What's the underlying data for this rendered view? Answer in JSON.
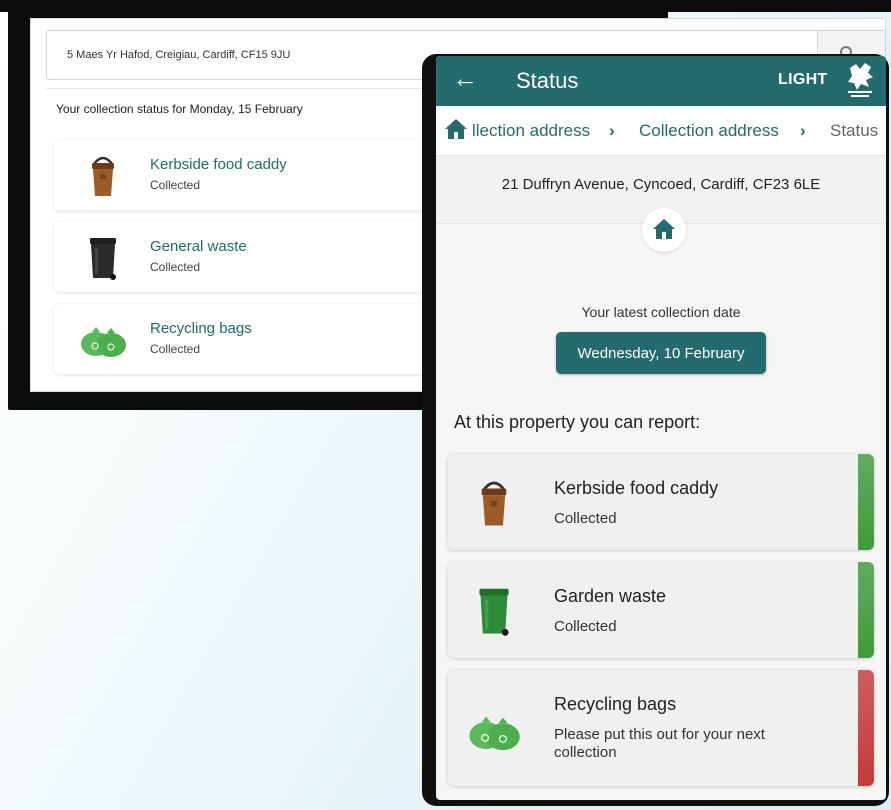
{
  "website": {
    "search_value": "5 Maes Yr Hafod, Creigiau, Cardiff, CF15 9JU",
    "heading": "Your collection status for Monday, 15 February",
    "items": [
      {
        "name": "Kerbside food caddy",
        "status": "Collected",
        "icon": "food-caddy-icon"
      },
      {
        "name": "General waste",
        "status": "Collected",
        "icon": "black-bin-icon"
      },
      {
        "name": "Recycling bags",
        "status": "Collected",
        "icon": "recycling-bags-icon"
      }
    ]
  },
  "app": {
    "title": "Status",
    "theme_toggle": "LIGHT",
    "breadcrumbs": [
      "llection address",
      "Collection address",
      "Status"
    ],
    "address": "21 Duffryn Avenue, Cyncoed, Cardiff, CF23 6LE",
    "latest_label": "Your latest collection date",
    "latest_date": "Wednesday, 10 February",
    "report_heading": "At this property you can report:",
    "items": [
      {
        "name": "Kerbside food caddy",
        "status": "Collected",
        "indicator": "#3f9a3a",
        "icon": "food-caddy-icon"
      },
      {
        "name": "Garden waste",
        "status": "Collected",
        "indicator": "#3f9a3a",
        "icon": "green-bin-icon"
      },
      {
        "name": "Recycling bags",
        "status": "Please put this out for your next collection",
        "indicator": "#c43a3a",
        "icon": "recycling-bags-icon"
      }
    ]
  },
  "colors": {
    "brand_teal": "#236b6d",
    "collected_green": "#3f9a3a",
    "pending_red": "#c43a3a"
  }
}
